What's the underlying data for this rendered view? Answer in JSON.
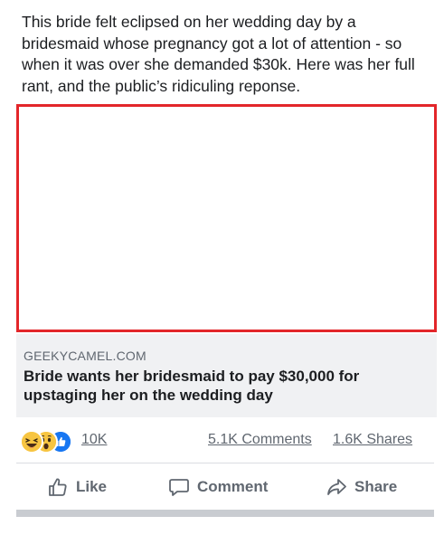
{
  "post": {
    "text": "This bride felt eclipsed on her wedding day by a bridesmaid whose pregnancy got a lot of attention - so when it was over she demanded $30k. Here was her full rant, and the public’s ridiculing reponse."
  },
  "link_preview": {
    "domain": "GEEKYCAMEL.COM",
    "title": "Bride wants her bridesmaid to pay $30,000 for upstaging her on the wedding day"
  },
  "stats": {
    "reactions": [
      "laughing-emoji-icon",
      "wow-emoji-icon",
      "like-reaction-icon"
    ],
    "reaction_count": "10K",
    "comments": "5.1K Comments",
    "shares": "1.6K Shares"
  },
  "actions": {
    "like": "Like",
    "comment": "Comment",
    "share": "Share"
  },
  "colors": {
    "media_border": "#e3262a",
    "preview_bg": "#f0f1f3",
    "secondary_text": "#606770",
    "like_blue": "#1877f2",
    "reaction_yellow": "#f7c542"
  }
}
